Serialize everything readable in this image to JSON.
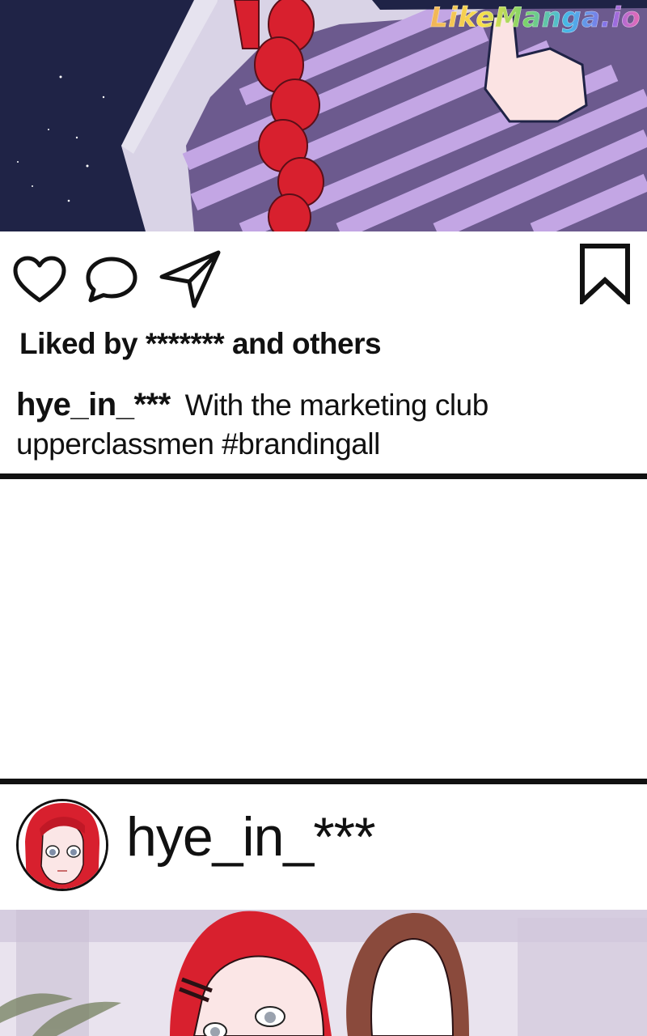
{
  "watermark": "LikeManga.io",
  "post1": {
    "likes_text": "Liked by ******* and others",
    "caption_user": "hye_in_***",
    "caption_text": "With the marketing club upperclassmen #brandingall",
    "icons": {
      "like": "heart-icon",
      "comment": "comment-bubble-icon",
      "share": "paper-plane-icon",
      "save": "bookmark-icon"
    }
  },
  "post2": {
    "username": "hye_in_***",
    "avatar": "profile-avatar"
  },
  "colors": {
    "divider": "#111111",
    "hair_red": "#d8202e",
    "sweater_stripe": "#b79ad8",
    "sweater_dark": "#6c5a8e",
    "coat_navy": "#1f2346"
  }
}
